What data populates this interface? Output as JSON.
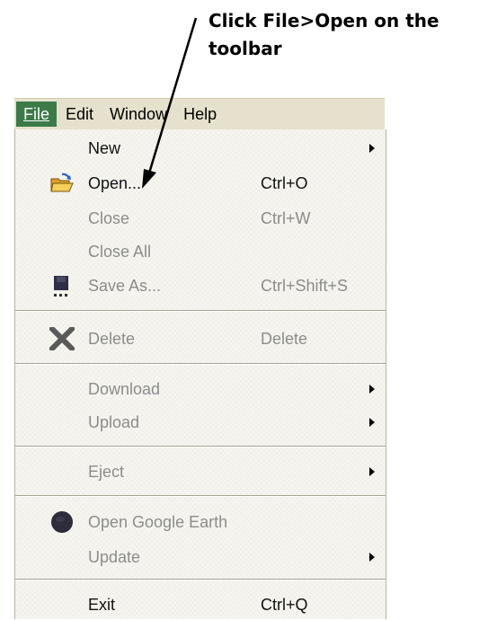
{
  "callout": {
    "line1": "Click File>Open on the",
    "line2": "toolbar"
  },
  "menubar": {
    "items": [
      {
        "label": "File",
        "active": true
      },
      {
        "label": "Edit"
      },
      {
        "label": "Window"
      },
      {
        "label": "Help"
      }
    ]
  },
  "file_menu": {
    "new": {
      "label": "New",
      "submenu": true,
      "enabled": true
    },
    "open": {
      "label": "Open...",
      "shortcut": "Ctrl+O",
      "enabled": true,
      "icon": "open-folder-icon"
    },
    "close": {
      "label": "Close",
      "shortcut": "Ctrl+W",
      "enabled": false
    },
    "close_all": {
      "label": "Close All",
      "enabled": false
    },
    "save_as": {
      "label": "Save As...",
      "shortcut": "Ctrl+Shift+S",
      "enabled": false,
      "icon": "save-icon"
    },
    "delete": {
      "label": "Delete",
      "shortcut": "Delete",
      "enabled": false,
      "icon": "delete-x-icon"
    },
    "download": {
      "label": "Download",
      "submenu": true,
      "enabled": false
    },
    "upload": {
      "label": "Upload",
      "submenu": true,
      "enabled": false
    },
    "eject": {
      "label": "Eject",
      "submenu": true,
      "enabled": false
    },
    "open_google_earth": {
      "label": "Open Google Earth",
      "enabled": false,
      "icon": "google-earth-icon"
    },
    "update": {
      "label": "Update",
      "submenu": true,
      "enabled": false
    },
    "exit": {
      "label": "Exit",
      "shortcut": "Ctrl+Q",
      "enabled": true
    }
  }
}
